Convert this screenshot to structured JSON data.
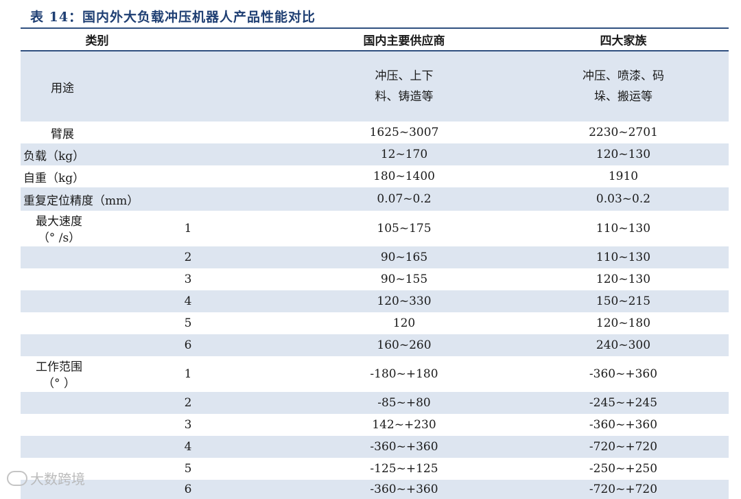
{
  "title": "表 14：国内外大负载冲压机器人产品性能对比",
  "headers": [
    "类别",
    "国内主要供应商",
    "四大家族"
  ],
  "usage": {
    "label": "用途",
    "domestic": "冲压、上下\n料、铸造等",
    "big4": "冲压、喷漆、码\n垛、搬运等"
  },
  "rows": [
    {
      "label": "臂展",
      "domestic": "1625~3007",
      "big4": "2230~2701"
    },
    {
      "label": "负载（kg）",
      "domestic": "12~170",
      "big4": "120~130"
    },
    {
      "label": "自重（kg）",
      "domestic": "180~1400",
      "big4": "1910"
    },
    {
      "label": "重复定位精度（mm）",
      "domestic": "0.07~0.2",
      "big4": "0.03~0.2"
    }
  ],
  "speed": {
    "label_line1": "最大速度",
    "label_line2": "（° /s）",
    "rows": [
      {
        "axis": "1",
        "domestic": "105~175",
        "big4": "110~130"
      },
      {
        "axis": "2",
        "domestic": "90~165",
        "big4": "110~130"
      },
      {
        "axis": "3",
        "domestic": "90~155",
        "big4": "120~130"
      },
      {
        "axis": "4",
        "domestic": "120~330",
        "big4": "150~215"
      },
      {
        "axis": "5",
        "domestic": "120",
        "big4": "120~180"
      },
      {
        "axis": "6",
        "domestic": "160~260",
        "big4": "240~300"
      }
    ]
  },
  "range": {
    "label_line1": "工作范围",
    "label_line2": "（° ）",
    "rows": [
      {
        "axis": "1",
        "domestic": "-180~+180",
        "big4": "-360~+360"
      },
      {
        "axis": "2",
        "domestic": "-85~+80",
        "big4": "-245~+245"
      },
      {
        "axis": "3",
        "domestic": "142~+230",
        "big4": "-360~+360"
      },
      {
        "axis": "4",
        "domestic": "-360~+360",
        "big4": "-720~+720"
      },
      {
        "axis": "5",
        "domestic": "-125~+125",
        "big4": "-250~+250"
      },
      {
        "axis": "6",
        "domestic": "-360~+360",
        "big4": "-720~+720"
      }
    ]
  },
  "watermark": "大数跨境",
  "colors": {
    "title": "#1f3f73",
    "shade": "#dde5f0",
    "rule": "#2f4f7f"
  }
}
